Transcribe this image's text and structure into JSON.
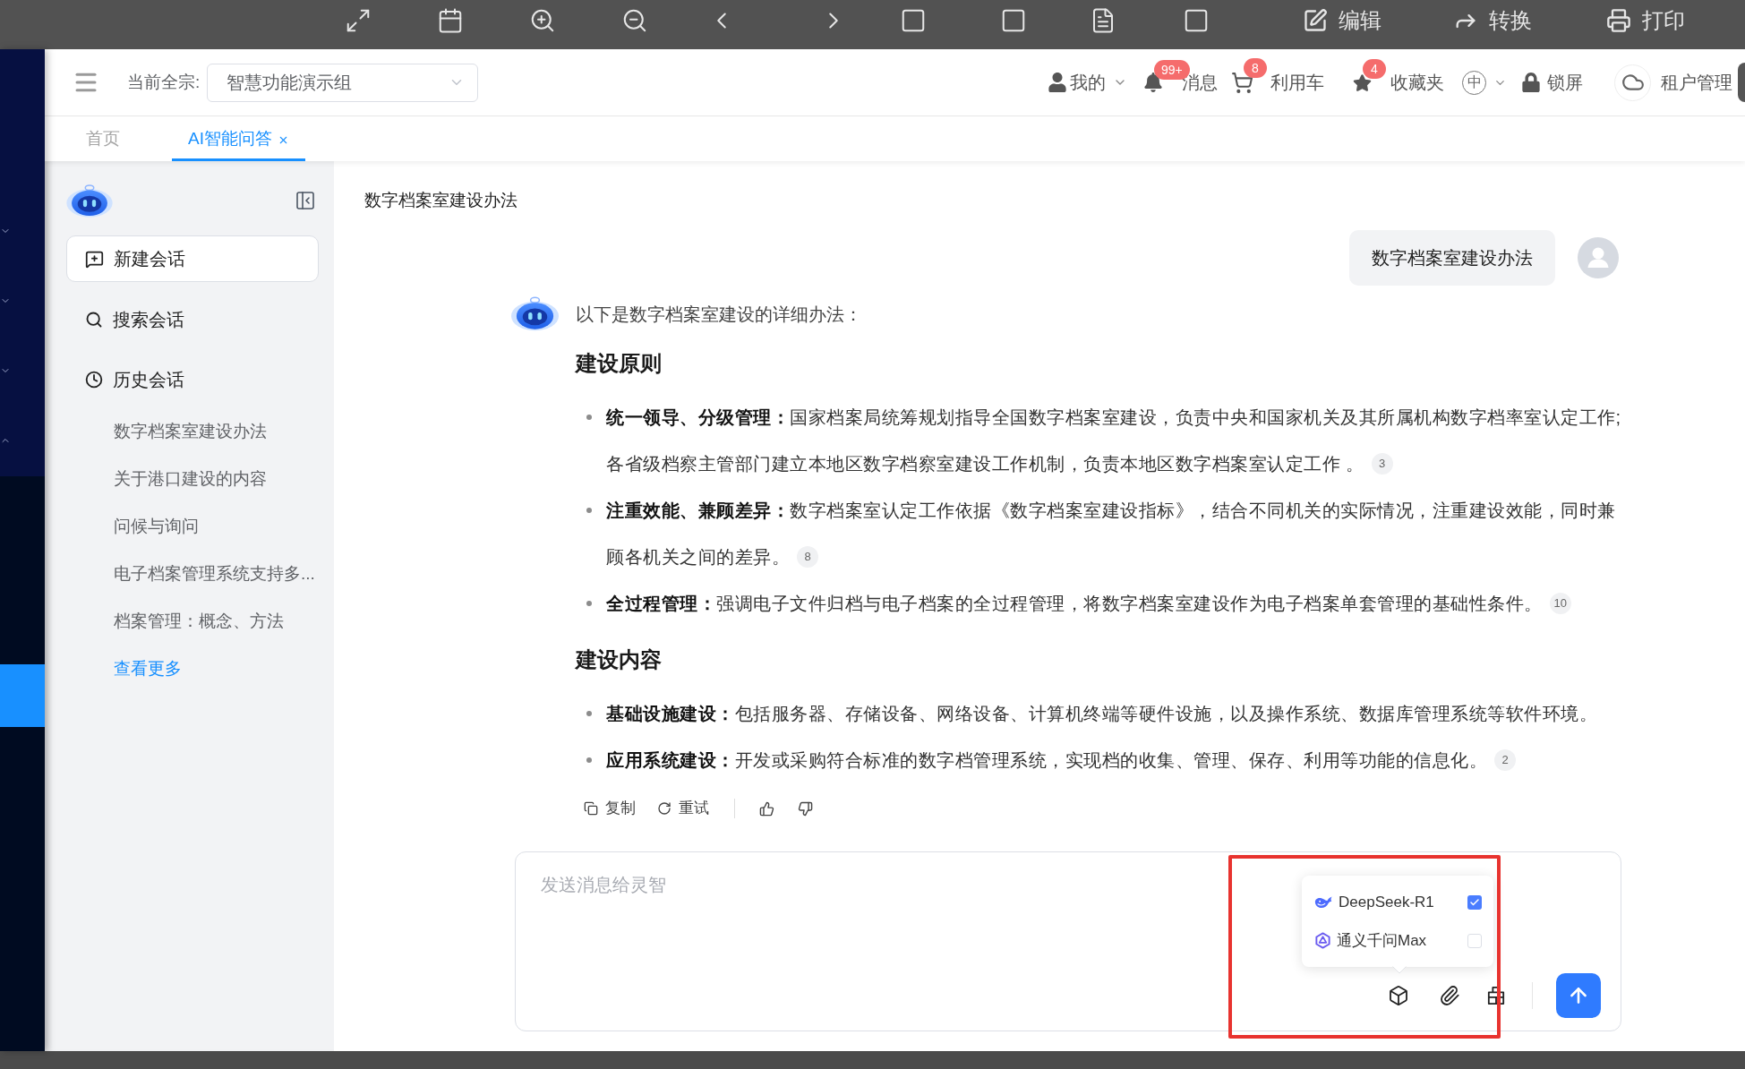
{
  "toolbar": {
    "buttons": [
      {
        "kind": "edit",
        "label": "编辑"
      },
      {
        "kind": "convert",
        "label": "转换"
      },
      {
        "kind": "print",
        "label": "打印"
      }
    ]
  },
  "left_nav": {
    "groups": [
      {
        "expanded": false
      },
      {
        "expanded": false
      },
      {
        "expanded": false
      },
      {
        "expanded": true,
        "items": [
          {
            "selected": false
          },
          {
            "selected": false
          },
          {
            "selected": false
          },
          {
            "selected": true
          }
        ]
      }
    ]
  },
  "header": {
    "fonds_label": "当前全宗:",
    "fonds_select": {
      "value": "智慧功能演示组"
    },
    "user_menu": {
      "label": "我的"
    },
    "messages": {
      "label": "消息",
      "badge": "99+"
    },
    "cart": {
      "label": "利用车",
      "badge": "8"
    },
    "favorites": {
      "label": "收藏夹",
      "badge": "4"
    },
    "language": {
      "label": "中"
    },
    "lock": {
      "label": "锁屏"
    },
    "tenant": {
      "label": "租户管理"
    }
  },
  "tabs": [
    {
      "label": "首页",
      "selected": false,
      "closable": false
    },
    {
      "label": "AI智能问答",
      "selected": true,
      "closable": true
    }
  ],
  "assistant_sidebar": {
    "new_chat": "新建会话",
    "search": "搜索会话",
    "history": {
      "label": "历史会话",
      "items": [
        "数字档案室建设办法",
        "关于港口建设的内容",
        "问候与询问",
        "电子档案管理系统支持多...",
        "档案管理：概念、方法"
      ]
    },
    "more_link": "查看更多"
  },
  "chat": {
    "title": "数字档案室建设办法",
    "messages": [
      {
        "kind": "user",
        "text": "数字档案室建设办法"
      },
      {
        "kind": "assistant",
        "intro": "以下是数字档案室建设的详细办法：",
        "sections": [
          {
            "heading": "建设原则",
            "items": [
              {
                "term": "统一领导、分级管理：",
                "text": "国家档案局统筹规划指导全国数字档案室建设，负责中央和国家机关及其所属机构数字档率室认定工作;各省级档察主管部门建立本地区数字档察室建设工作机制，负责本地区数字档案室认定工作 。",
                "citation": "3"
              },
              {
                "term": "注重效能、兼顾差异：",
                "text": "数字档案室认定工作依据《数字档案室建设指标》，结合不同机关的实际情况，注重建设效能，同时兼顾各机关之间的差异。",
                "citation": "8"
              },
              {
                "term": "全过程管理：",
                "text": "强调电子文件归档与电子档案的全过程管理，将数字档案室建设作为电子档案单套管理的基础性条件。",
                "citation": "10"
              }
            ]
          },
          {
            "heading": "建设内容",
            "items": [
              {
                "term": "基础设施建设：",
                "text": "包括服务器、存储设备、网络设备、计算机终端等硬件设施，以及操作系统、数据库管理系统等软件环境。"
              },
              {
                "term": "应用系统建设：",
                "text": "开发或采购符合标准的数字档管理系统，实现档的收集、管理、保存、利用等功能的信息化。",
                "citation": "2"
              }
            ]
          }
        ],
        "actions": [
          {
            "kind": "copy",
            "label": "复制"
          },
          {
            "kind": "retry",
            "label": "重试"
          },
          {
            "kind": "like"
          },
          {
            "kind": "dislike"
          }
        ]
      }
    ],
    "composer": {
      "placeholder": "发送消息给灵智",
      "models": [
        {
          "name": "DeepSeek-R1",
          "checked": true
        },
        {
          "name": "通义千问Max",
          "checked": false
        }
      ]
    }
  }
}
